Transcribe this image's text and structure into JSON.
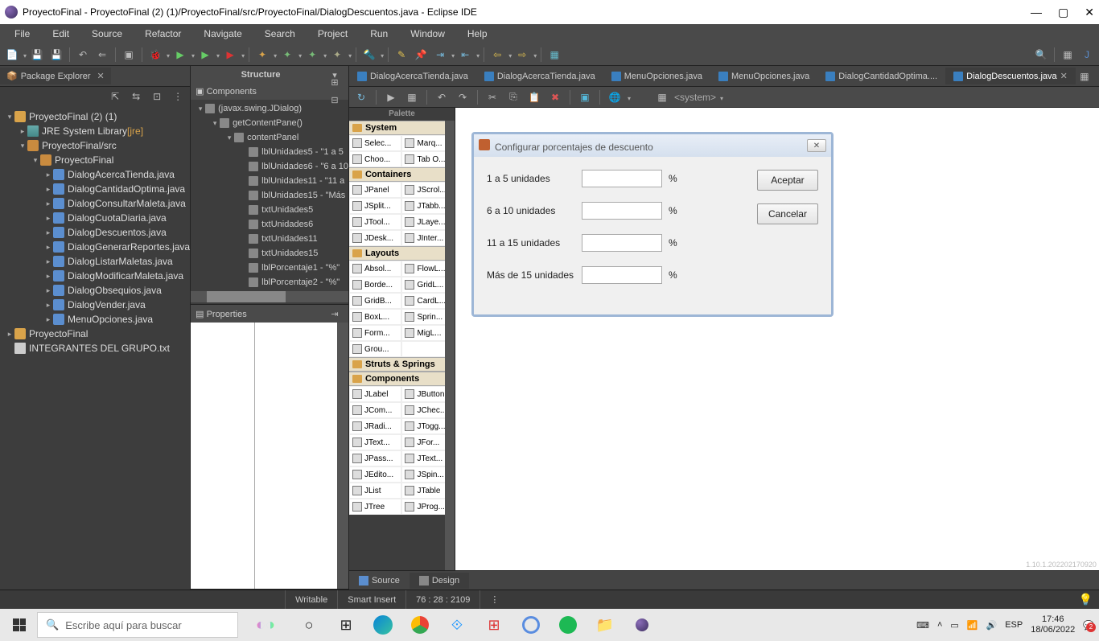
{
  "window": {
    "title": "ProyectoFinal - ProyectoFinal (2) (1)/ProyectoFinal/src/ProyectoFinal/DialogDescuentos.java - Eclipse IDE"
  },
  "menubar": [
    "File",
    "Edit",
    "Source",
    "Refactor",
    "Navigate",
    "Search",
    "Project",
    "Run",
    "Window",
    "Help"
  ],
  "views": {
    "package_explorer": {
      "title": "Package Explorer",
      "tree": {
        "project": "ProyectoFinal (2) (1)",
        "jre": "JRE System Library",
        "jre_tag": "[jre]",
        "src": "ProyectoFinal/src",
        "pkg": "ProyectoFinal",
        "files": [
          "DialogAcercaTienda.java",
          "DialogCantidadOptima.java",
          "DialogConsultarMaleta.java",
          "DialogCuotaDiaria.java",
          "DialogDescuentos.java",
          "DialogGenerarReportes.java",
          "DialogListarMaletas.java",
          "DialogModificarMaleta.java",
          "DialogObsequios.java",
          "DialogVender.java",
          "MenuOpciones.java"
        ],
        "other_project": "ProyectoFinal",
        "txtfile": "INTEGRANTES DEL GRUPO.txt"
      }
    },
    "structure": {
      "title": "Structure"
    },
    "components": {
      "title": "Components",
      "tree": [
        {
          "depth": 0,
          "tw": "▾",
          "label": "(javax.swing.JDialog)"
        },
        {
          "depth": 1,
          "tw": "▾",
          "label": "getContentPane()"
        },
        {
          "depth": 2,
          "tw": "▾",
          "label": "contentPanel"
        },
        {
          "depth": 3,
          "tw": "",
          "label": "lblUnidades5 - \"1 a 5"
        },
        {
          "depth": 3,
          "tw": "",
          "label": "lblUnidades6 - \"6 a 10"
        },
        {
          "depth": 3,
          "tw": "",
          "label": "lblUnidades11 - \"11 a"
        },
        {
          "depth": 3,
          "tw": "",
          "label": "lblUnidades15 - \"Más"
        },
        {
          "depth": 3,
          "tw": "",
          "label": "txtUnidades5"
        },
        {
          "depth": 3,
          "tw": "",
          "label": "txtUnidades6"
        },
        {
          "depth": 3,
          "tw": "",
          "label": "txtUnidades11"
        },
        {
          "depth": 3,
          "tw": "",
          "label": "txtUnidades15"
        },
        {
          "depth": 3,
          "tw": "",
          "label": "lblPorcentaje1 - \"%\""
        },
        {
          "depth": 3,
          "tw": "",
          "label": "lblPorcentaje2 - \"%\""
        }
      ]
    },
    "properties": {
      "title": "Properties"
    }
  },
  "editor": {
    "tabs": [
      {
        "label": "DialogAcercaTienda.java",
        "active": false
      },
      {
        "label": "DialogAcercaTienda.java",
        "active": false
      },
      {
        "label": "MenuOpciones.java",
        "active": false
      },
      {
        "label": "MenuOpciones.java",
        "active": false
      },
      {
        "label": "DialogCantidadOptima....",
        "active": false
      },
      {
        "label": "DialogDescuentos.java",
        "active": true
      }
    ],
    "system_label": "<system>",
    "bottom_tabs": {
      "source": "Source",
      "design": "Design"
    }
  },
  "palette": {
    "title": "Palette",
    "groups": [
      {
        "name": "System",
        "items": [
          [
            "Selec...",
            "Marq..."
          ],
          [
            "Choo...",
            "Tab O..."
          ]
        ]
      },
      {
        "name": "Containers",
        "items": [
          [
            "JPanel",
            "JScrol..."
          ],
          [
            "JSplit...",
            "JTabb..."
          ],
          [
            "JTool...",
            "JLaye..."
          ],
          [
            "JDesk...",
            "JInter..."
          ]
        ]
      },
      {
        "name": "Layouts",
        "items": [
          [
            "Absol...",
            "FlowL..."
          ],
          [
            "Borde...",
            "GridL..."
          ],
          [
            "GridB...",
            "CardL..."
          ],
          [
            "BoxL...",
            "Sprin..."
          ],
          [
            "Form...",
            "MigL..."
          ],
          [
            "Grou...",
            ""
          ]
        ]
      },
      {
        "name": "Struts & Springs",
        "items": []
      },
      {
        "name": "Components",
        "items": [
          [
            "JLabel",
            "JButton"
          ],
          [
            "JCom...",
            "JChec..."
          ],
          [
            "JRadi...",
            "JTogg..."
          ],
          [
            "JText...",
            "JFor..."
          ],
          [
            "JPass...",
            "JText..."
          ],
          [
            "JEdito...",
            "JSpin..."
          ],
          [
            "JList",
            "JTable"
          ],
          [
            "JTree",
            "JProg..."
          ]
        ]
      }
    ]
  },
  "dialog_preview": {
    "title": "Configurar porcentajes de descuento",
    "rows": [
      {
        "label": "1 a 5 unidades",
        "suffix": "%"
      },
      {
        "label": "6 a 10 unidades",
        "suffix": "%"
      },
      {
        "label": "11 a 15 unidades",
        "suffix": "%"
      },
      {
        "label": "Más de  15  unidades",
        "suffix": "%"
      }
    ],
    "btn_ok": "Aceptar",
    "btn_cancel": "Cancelar"
  },
  "statusbar": {
    "writable": "Writable",
    "mode": "Smart Insert",
    "pos": "76 : 28 : 2109"
  },
  "taskbar": {
    "search_placeholder": "Escribe aquí para buscar",
    "lang": "ESP",
    "time": "17:46",
    "date": "18/06/2022"
  },
  "canvas_footer": "1.10.1.202202170920"
}
